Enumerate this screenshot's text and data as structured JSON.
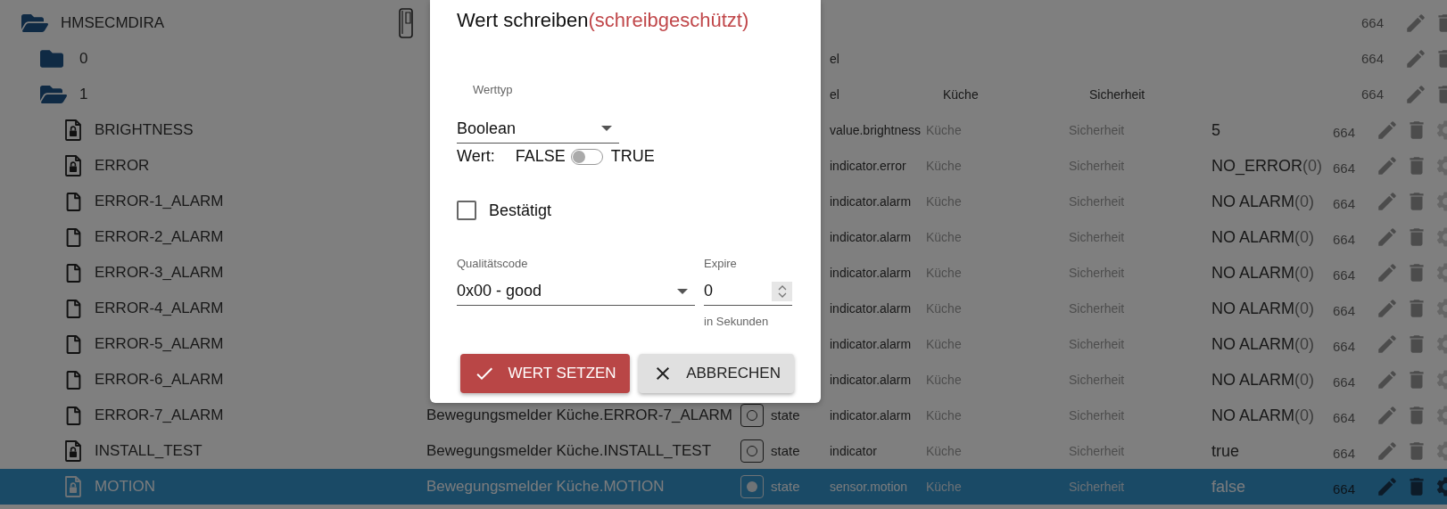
{
  "tree": [
    {
      "name": "HMSECMDIRA",
      "kind": "device",
      "expanded": true,
      "selected": false,
      "acl": "664",
      "children": [
        {
          "name": "0",
          "kind": "channel",
          "expanded": false,
          "selected": false,
          "role": "el",
          "acl": "664"
        },
        {
          "name": "1",
          "kind": "channel",
          "expanded": true,
          "selected": false,
          "role": "el",
          "room": "Küche",
          "function": "Sicherheit",
          "acl": "664",
          "children": [
            {
              "name": "BRIGHTNESS",
              "kind": "state",
              "locked": true,
              "selected": false,
              "role": "value.brightness",
              "room": "Küche",
              "function": "Sicherheit",
              "value": "5",
              "acl": "664"
            },
            {
              "name": "ERROR",
              "kind": "state",
              "locked": true,
              "selected": false,
              "role": "indicator.error",
              "room": "Küche",
              "function": "Sicherheit",
              "value": "NO_ERROR",
              "value_code": "(0)",
              "acl": "664"
            },
            {
              "name": "ERROR-1_ALARM",
              "kind": "state",
              "locked": false,
              "selected": false,
              "role": "indicator.alarm",
              "room": "Küche",
              "function": "Sicherheit",
              "value": "NO ALARM",
              "value_code": "(0)",
              "acl": "664"
            },
            {
              "name": "ERROR-2_ALARM",
              "kind": "state",
              "locked": false,
              "selected": false,
              "role": "indicator.alarm",
              "room": "Küche",
              "function": "Sicherheit",
              "value": "NO ALARM",
              "value_code": "(0)",
              "acl": "664"
            },
            {
              "name": "ERROR-3_ALARM",
              "kind": "state",
              "locked": false,
              "selected": false,
              "role": "indicator.alarm",
              "room": "Küche",
              "function": "Sicherheit",
              "value": "NO ALARM",
              "value_code": "(0)",
              "acl": "664"
            },
            {
              "name": "ERROR-4_ALARM",
              "kind": "state",
              "locked": false,
              "selected": false,
              "role": "indicator.alarm",
              "room": "Küche",
              "function": "Sicherheit",
              "value": "NO ALARM",
              "value_code": "(0)",
              "acl": "664"
            },
            {
              "name": "ERROR-5_ALARM",
              "kind": "state",
              "locked": false,
              "selected": false,
              "role": "indicator.alarm",
              "room": "Küche",
              "function": "Sicherheit",
              "value": "NO ALARM",
              "value_code": "(0)",
              "acl": "664"
            },
            {
              "name": "ERROR-6_ALARM",
              "kind": "state",
              "locked": false,
              "selected": false,
              "role": "indicator.alarm",
              "room": "Küche",
              "function": "Sicherheit",
              "value": "NO ALARM",
              "value_code": "(0)",
              "acl": "664"
            },
            {
              "name": "ERROR-7_ALARM",
              "kind": "state",
              "locked": false,
              "selected": false,
              "description": "Bewegungsmelder Küche.ERROR-7_ALARM",
              "type": "state",
              "role": "indicator.alarm",
              "room": "Küche",
              "function": "Sicherheit",
              "value": "NO ALARM",
              "value_code": "(0)",
              "acl": "664"
            },
            {
              "name": "INSTALL_TEST",
              "kind": "state",
              "locked": true,
              "selected": false,
              "description": "Bewegungsmelder Küche.INSTALL_TEST",
              "type": "state",
              "role": "indicator",
              "room": "Küche",
              "function": "Sicherheit",
              "value": "true",
              "acl": "664"
            },
            {
              "name": "MOTION",
              "kind": "state",
              "locked": true,
              "selected": true,
              "description": "Bewegungsmelder Küche.MOTION",
              "type": "state",
              "role": "sensor.motion",
              "room": "Küche",
              "function": "Sicherheit",
              "value": "false",
              "acl": "664"
            }
          ]
        }
      ]
    }
  ],
  "dialog": {
    "title": "Wert schreiben",
    "title_note": "(schreibgeschützt)",
    "value_type": {
      "label": "Werttyp",
      "value": "Boolean"
    },
    "value_toggle": {
      "label": "Wert:",
      "off_label": "FALSE",
      "on_label": "TRUE",
      "on": false
    },
    "acknowledged": {
      "label": "Bestätigt",
      "checked": false
    },
    "quality": {
      "label": "Qualitätscode",
      "value": "0x00 - good"
    },
    "expire": {
      "label": "Expire",
      "value": "0",
      "helper": "in Sekunden"
    },
    "buttons": [
      {
        "label": "WERT SETZEN",
        "kind": "confirm"
      },
      {
        "label": "ABBRECHEN",
        "kind": "cancel"
      }
    ]
  }
}
